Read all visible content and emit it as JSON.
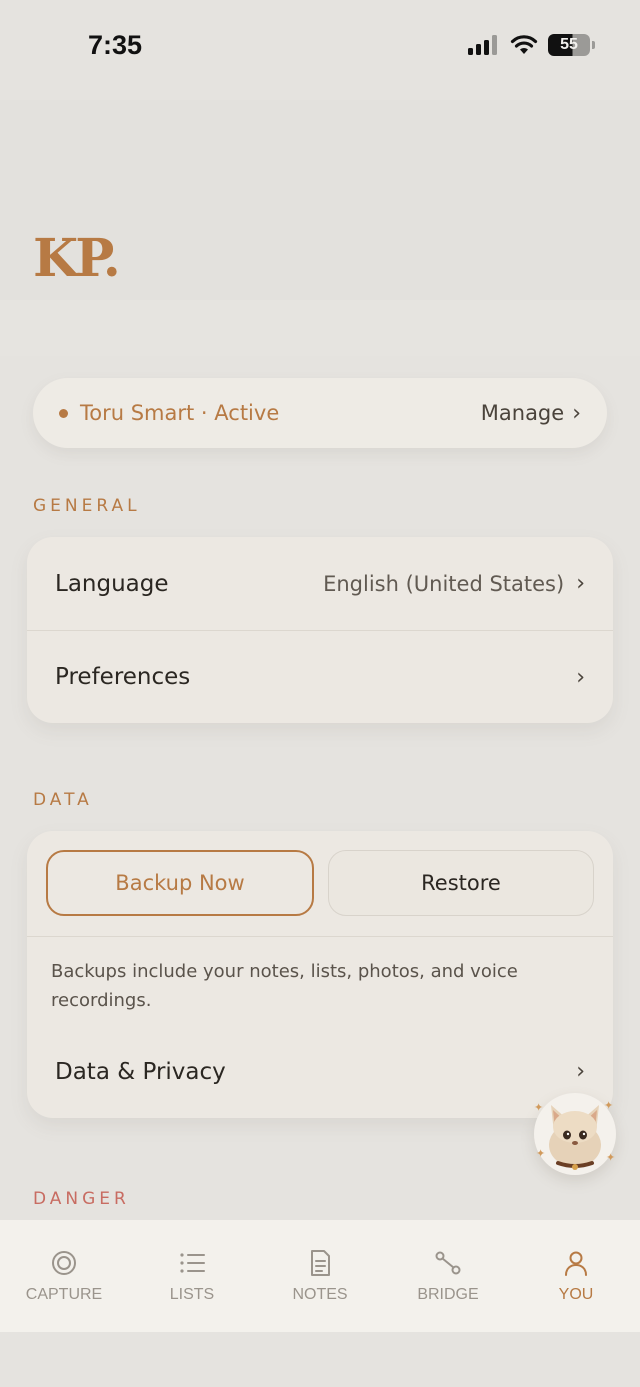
{
  "status_bar": {
    "time": "7:35",
    "battery": "55"
  },
  "profile": {
    "monogram": "KP."
  },
  "subscription": {
    "status": "Toru Smart · Active",
    "manage_label": "Manage"
  },
  "general": {
    "label": "GENERAL",
    "rows": [
      {
        "label": "Language",
        "value": "English (United States)"
      },
      {
        "label": "Preferences",
        "value": ""
      }
    ]
  },
  "data": {
    "label": "DATA",
    "backup_label": "Backup Now",
    "restore_label": "Restore",
    "hint": "Backups include your notes, lists, photos, and voice recordings.",
    "privacy_label": "Data & Privacy"
  },
  "danger": {
    "label": "DANGER"
  },
  "tabs": [
    {
      "label": "CAPTURE",
      "icon": "target-icon"
    },
    {
      "label": "LISTS",
      "icon": "list-icon"
    },
    {
      "label": "NOTES",
      "icon": "document-icon"
    },
    {
      "label": "BRIDGE",
      "icon": "bridge-icon"
    },
    {
      "label": "YOU",
      "icon": "person-icon",
      "active": true
    }
  ],
  "colors": {
    "accent": "#b77a44",
    "danger": "#c86c62",
    "background": "#e5e3df",
    "card": "#ece8e2"
  }
}
